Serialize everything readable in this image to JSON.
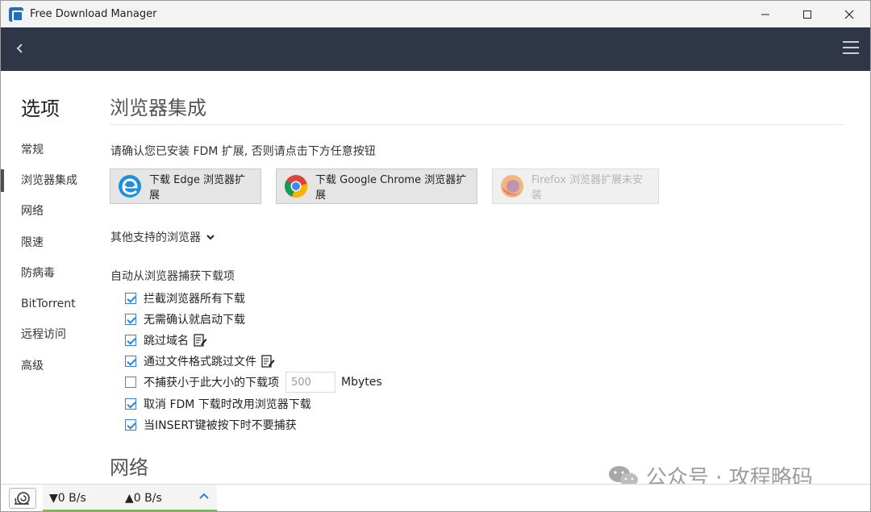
{
  "window": {
    "title": "Free Download Manager"
  },
  "sidebar": {
    "title": "选项",
    "items": [
      {
        "label": "常规"
      },
      {
        "label": "浏览器集成",
        "active": true
      },
      {
        "label": "网络"
      },
      {
        "label": "限速"
      },
      {
        "label": "防病毒"
      },
      {
        "label": "BitTorrent"
      },
      {
        "label": "远程访问"
      },
      {
        "label": "高级"
      }
    ]
  },
  "main": {
    "section_title": "浏览器集成",
    "notice": "请确认您已安装 FDM 扩展, 否则请点击下方任意按钮",
    "browser_buttons": [
      {
        "label": "下载 Edge 浏览器扩展",
        "icon": "edge-icon"
      },
      {
        "label": "下载 Google Chrome 浏览器扩展",
        "icon": "chrome-icon"
      },
      {
        "label": "Firefox 浏览器扩展未安装",
        "icon": "firefox-icon",
        "disabled": true
      }
    ],
    "other_browsers": "其他支持的浏览器",
    "capture_title": "自动从浏览器捕获下载项",
    "options": [
      {
        "label": "拦截浏览器所有下载",
        "checked": true
      },
      {
        "label": "无需确认就启动下载",
        "checked": true
      },
      {
        "label": "跳过域名",
        "checked": true,
        "edit": true
      },
      {
        "label": "通过文件格式跳过文件",
        "checked": true,
        "edit": true
      },
      {
        "label": "不捕获小于此大小的下载项",
        "checked": false,
        "size_value": "500",
        "unit": "Mbytes"
      },
      {
        "label": "取消 FDM 下载时改用浏览器下载",
        "checked": true
      },
      {
        "label": "当INSERT键被按下时不要捕获",
        "checked": true
      }
    ],
    "next_section_title": "网络"
  },
  "watermark": {
    "text": "公众号 · 攻程略码"
  },
  "status": {
    "download_speed": "▼0 B/s",
    "upload_speed": "▲0 B/s"
  },
  "colors": {
    "header": "#2f3646",
    "accent": "#2f82d8",
    "speed_bar": "#7ac143"
  }
}
